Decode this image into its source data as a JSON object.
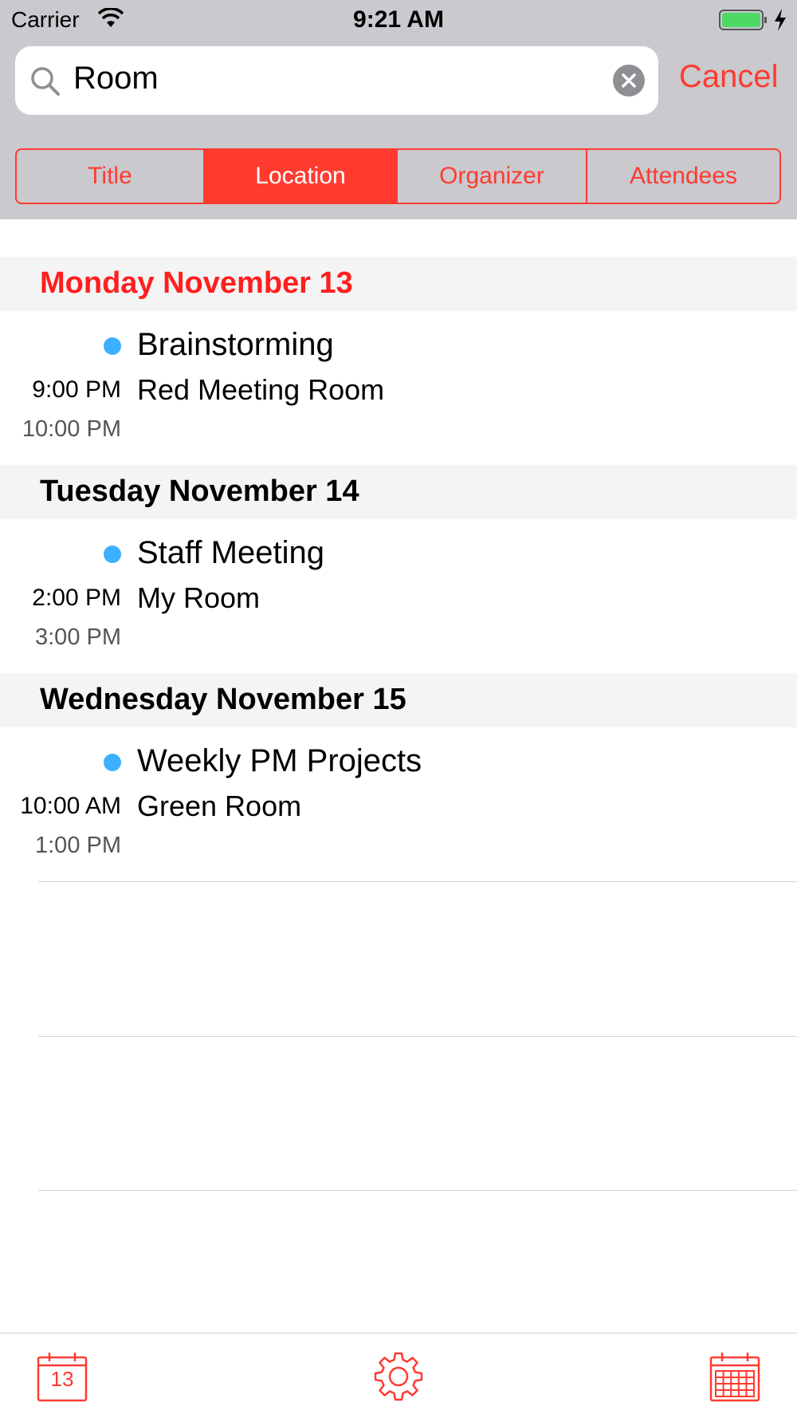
{
  "status_bar": {
    "carrier": "Carrier",
    "time": "9:21 AM"
  },
  "search": {
    "query": "Room",
    "cancel_label": "Cancel"
  },
  "segments": [
    {
      "label": "Title",
      "selected": false
    },
    {
      "label": "Location",
      "selected": true
    },
    {
      "label": "Organizer",
      "selected": false
    },
    {
      "label": "Attendees",
      "selected": false
    }
  ],
  "sections": [
    {
      "date": "Monday November 13",
      "today": true,
      "events": [
        {
          "title": "Brainstorming",
          "location": "Red Meeting Room",
          "start": "9:00 PM",
          "end": "10:00 PM",
          "color": "#3cb0ff"
        }
      ]
    },
    {
      "date": "Tuesday November 14",
      "today": false,
      "events": [
        {
          "title": "Staff Meeting",
          "location": "My Room",
          "start": "2:00 PM",
          "end": "3:00 PM",
          "color": "#3cb0ff"
        }
      ]
    },
    {
      "date": "Wednesday November 15",
      "today": false,
      "events": [
        {
          "title": "Weekly PM Projects",
          "location": "Green Room",
          "start": "10:00 AM",
          "end": "1:00 PM",
          "color": "#3cb0ff"
        }
      ]
    }
  ],
  "tabbar": {
    "today_number": "13",
    "items": [
      "calendar-today-icon",
      "gear-icon",
      "calendar-month-icon"
    ]
  },
  "colors": {
    "accent": "#ff3b30",
    "today_header": "#ff1f1f",
    "event_dot": "#3cb0ff",
    "header_bg": "#c9c9ce"
  }
}
